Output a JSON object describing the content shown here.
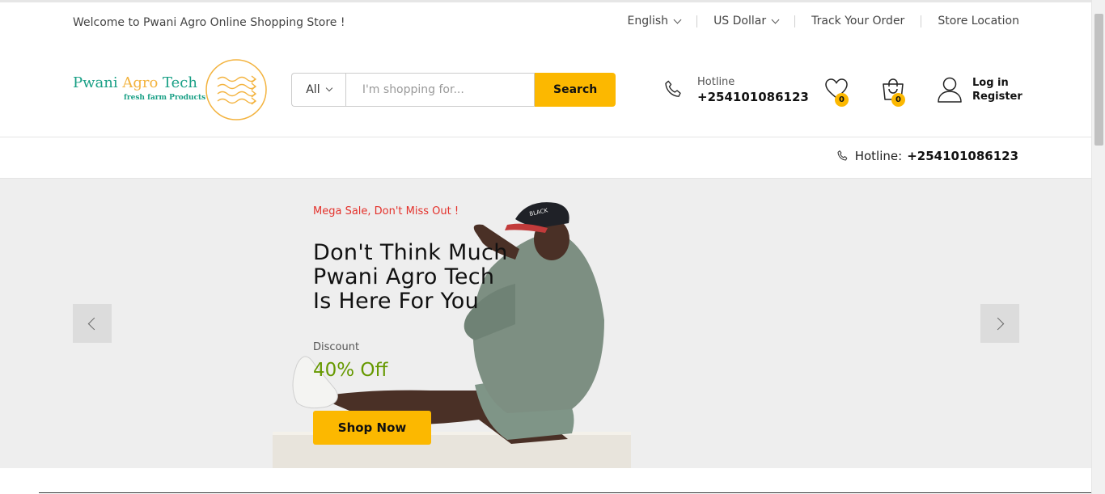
{
  "topbar": {
    "welcome": "Welcome to Pwani Agro Online Shopping Store !",
    "language": "English",
    "currency": "US Dollar",
    "track_order": "Track Your Order",
    "store_location": "Store Location"
  },
  "header": {
    "logo": {
      "name_part1": "Pwani ",
      "name_part2": "Agro",
      "name_part3": " Tech",
      "tagline": "fresh farm Products"
    },
    "search": {
      "category": "All",
      "placeholder": "I'm shopping for...",
      "button": "Search"
    },
    "hotline": {
      "label": "Hotline",
      "number": "+254101086123"
    },
    "wishlist": {
      "count": "0",
      "icon": "heart-icon"
    },
    "cart": {
      "count": "0",
      "icon": "shopping-bag-icon"
    },
    "account": {
      "login": "Log in",
      "register": "Register",
      "icon": "user-icon"
    }
  },
  "navbar": {
    "hotline_label": "Hotline:",
    "hotline_number": "+254101086123"
  },
  "hero": {
    "eyebrow": "Mega Sale, Don't Miss Out !",
    "title": "Don't Think Much\nPwani Agro Tech\nIs Here For You",
    "discount_label": "Discount",
    "discount_value": "40% Off",
    "button": "Shop Now"
  },
  "colors": {
    "accent": "#fcb800",
    "brand_green": "#1aa086",
    "logo_orange": "#f3b33f",
    "sale_red": "#e4312b",
    "discount_green": "#669900"
  }
}
